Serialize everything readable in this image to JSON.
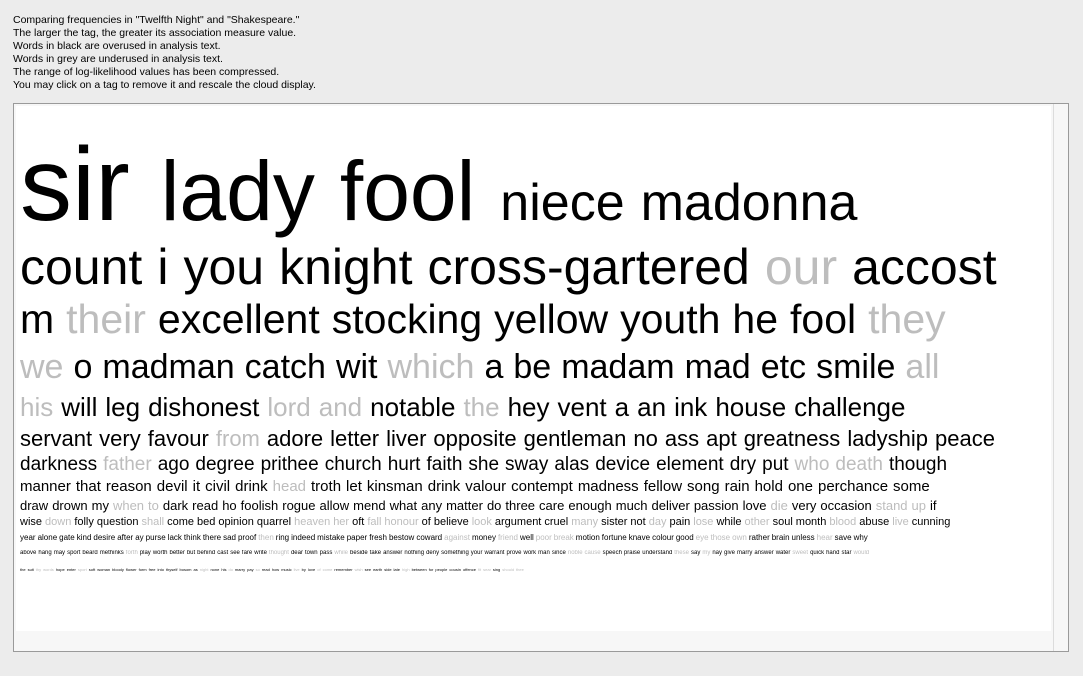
{
  "header_lines": [
    "Comparing frequencies in \"Twelfth Night\" and \"Shakespeare.\"",
    "The larger the tag, the greater its association measure value.",
    "Words in black are overused in analysis text.",
    "Words in grey are underused in analysis text.",
    "The range of log-likelihood values has been compressed.",
    "You may click on a tag to remove it and rescale the cloud display."
  ],
  "colors": {
    "overused": "#000000",
    "underused": "#bdbdbd"
  },
  "lines": [
    {
      "size": 104,
      "words": [
        [
          "sir",
          "o"
        ]
      ]
    },
    {
      "size": 84,
      "words": [
        [
          "lady",
          "o"
        ],
        [
          "fool",
          "o"
        ]
      ]
    },
    {
      "size": 52,
      "words": [
        [
          "niece",
          "o"
        ],
        [
          "madonna",
          "o"
        ]
      ]
    },
    {
      "size": 50,
      "words": [
        [
          "count",
          "o"
        ],
        [
          "i",
          "o"
        ],
        [
          "you",
          "o"
        ],
        [
          "knight",
          "o"
        ],
        [
          "cross-gartered",
          "o"
        ],
        [
          "our",
          "u"
        ],
        [
          "accost",
          "o"
        ]
      ]
    },
    {
      "size": 41,
      "words": [
        [
          "m",
          "o"
        ],
        [
          "their",
          "u"
        ],
        [
          "excellent",
          "o"
        ],
        [
          "stocking",
          "o"
        ],
        [
          "yellow",
          "o"
        ],
        [
          "youth",
          "o"
        ],
        [
          "he",
          "o"
        ],
        [
          "fool",
          "o"
        ],
        [
          "they",
          "u"
        ]
      ]
    },
    {
      "size": 34,
      "words": [
        [
          "we",
          "u"
        ],
        [
          "o",
          "o"
        ],
        [
          "madman",
          "o"
        ],
        [
          "catch",
          "o"
        ],
        [
          "wit",
          "o"
        ],
        [
          "which",
          "u"
        ],
        [
          "a",
          "o"
        ],
        [
          "be",
          "o"
        ],
        [
          "madam",
          "o"
        ],
        [
          "mad",
          "o"
        ],
        [
          "etc",
          "o"
        ],
        [
          "smile",
          "o"
        ],
        [
          "all",
          "u"
        ]
      ]
    },
    {
      "size": 26,
      "words": [
        [
          "his",
          "u"
        ],
        [
          "will",
          "o"
        ],
        [
          "leg",
          "o"
        ],
        [
          "dishonest",
          "o"
        ],
        [
          "lord",
          "u"
        ],
        [
          "and",
          "u"
        ],
        [
          "notable",
          "o"
        ],
        [
          "the",
          "u"
        ],
        [
          "hey",
          "o"
        ],
        [
          "vent",
          "o"
        ],
        [
          "a",
          "o"
        ],
        [
          "an",
          "o"
        ],
        [
          "ink",
          "o"
        ],
        [
          "house",
          "o"
        ],
        [
          "challenge",
          "o"
        ]
      ]
    },
    {
      "size": 22,
      "words": [
        [
          "servant",
          "o"
        ],
        [
          "very",
          "o"
        ],
        [
          "favour",
          "o"
        ],
        [
          "from",
          "u"
        ],
        [
          "adore",
          "o"
        ],
        [
          "letter",
          "o"
        ],
        [
          "liver",
          "o"
        ],
        [
          "opposite",
          "o"
        ],
        [
          "gentleman",
          "o"
        ],
        [
          "no",
          "o"
        ],
        [
          "ass",
          "o"
        ],
        [
          "apt",
          "o"
        ],
        [
          "greatness",
          "o"
        ],
        [
          "ladyship",
          "o"
        ],
        [
          "peace",
          "o"
        ]
      ]
    },
    {
      "size": 19,
      "words": [
        [
          "darkness",
          "o"
        ],
        [
          "father",
          "u"
        ],
        [
          "ago",
          "o"
        ],
        [
          "degree",
          "o"
        ],
        [
          "prithee",
          "o"
        ],
        [
          "church",
          "o"
        ],
        [
          "hurt",
          "o"
        ],
        [
          "faith",
          "o"
        ],
        [
          "she",
          "o"
        ],
        [
          "sway",
          "o"
        ],
        [
          "alas",
          "o"
        ],
        [
          "device",
          "o"
        ],
        [
          "element",
          "o"
        ],
        [
          "dry",
          "o"
        ],
        [
          "put",
          "o"
        ],
        [
          "who",
          "u"
        ],
        [
          "death",
          "u"
        ],
        [
          "though",
          "o"
        ]
      ]
    },
    {
      "size": 15,
      "words": [
        [
          "manner",
          "o"
        ],
        [
          "that",
          "o"
        ],
        [
          "reason",
          "o"
        ],
        [
          "devil",
          "o"
        ],
        [
          "it",
          "o"
        ],
        [
          "civil",
          "o"
        ],
        [
          "drink",
          "o"
        ],
        [
          "head",
          "u"
        ],
        [
          "troth",
          "o"
        ],
        [
          "let",
          "o"
        ],
        [
          "kinsman",
          "o"
        ],
        [
          "drink",
          "o"
        ],
        [
          "valour",
          "o"
        ],
        [
          "contempt",
          "o"
        ],
        [
          "madness",
          "o"
        ],
        [
          "fellow",
          "o"
        ],
        [
          "song",
          "o"
        ],
        [
          "rain",
          "o"
        ],
        [
          "hold",
          "o"
        ],
        [
          "one",
          "o"
        ],
        [
          "perchance",
          "o"
        ],
        [
          "some",
          "o"
        ]
      ]
    },
    {
      "size": 13,
      "words": [
        [
          "draw",
          "o"
        ],
        [
          "drown",
          "o"
        ],
        [
          "my",
          "o"
        ],
        [
          "when",
          "u"
        ],
        [
          "to",
          "u"
        ],
        [
          "dark",
          "o"
        ],
        [
          "read",
          "o"
        ],
        [
          "ho",
          "o"
        ],
        [
          "foolish",
          "o"
        ],
        [
          "rogue",
          "o"
        ],
        [
          "allow",
          "o"
        ],
        [
          "mend",
          "o"
        ],
        [
          "what",
          "o"
        ],
        [
          "any",
          "o"
        ],
        [
          "matter",
          "o"
        ],
        [
          "do",
          "o"
        ],
        [
          "three",
          "o"
        ],
        [
          "care",
          "o"
        ],
        [
          "enough",
          "o"
        ],
        [
          "much",
          "o"
        ],
        [
          "deliver",
          "o"
        ],
        [
          "passion",
          "o"
        ],
        [
          "love",
          "o"
        ],
        [
          "die",
          "u"
        ],
        [
          "very",
          "o"
        ],
        [
          "occasion",
          "o"
        ],
        [
          "stand",
          "u"
        ],
        [
          "up",
          "u"
        ],
        [
          "if",
          "o"
        ]
      ]
    },
    {
      "size": 11,
      "words": [
        [
          "wise",
          "o"
        ],
        [
          "down",
          "u"
        ],
        [
          "folly",
          "o"
        ],
        [
          "question",
          "o"
        ],
        [
          "shall",
          "u"
        ],
        [
          "come",
          "o"
        ],
        [
          "bed",
          "o"
        ],
        [
          "opinion",
          "o"
        ],
        [
          "quarrel",
          "o"
        ],
        [
          "heaven",
          "u"
        ],
        [
          "her",
          "u"
        ],
        [
          "oft",
          "o"
        ],
        [
          "fall",
          "u"
        ],
        [
          "honour",
          "u"
        ],
        [
          "of",
          "o"
        ],
        [
          "believe",
          "o"
        ],
        [
          "look",
          "u"
        ],
        [
          "argument",
          "o"
        ],
        [
          "cruel",
          "o"
        ],
        [
          "many",
          "u"
        ],
        [
          "sister",
          "o"
        ],
        [
          "not",
          "o"
        ],
        [
          "day",
          "u"
        ],
        [
          "pain",
          "o"
        ],
        [
          "lose",
          "u"
        ],
        [
          "while",
          "o"
        ],
        [
          "other",
          "u"
        ],
        [
          "soul",
          "o"
        ],
        [
          "month",
          "o"
        ],
        [
          "blood",
          "u"
        ],
        [
          "abuse",
          "o"
        ],
        [
          "live",
          "u"
        ],
        [
          "cunning",
          "o"
        ]
      ]
    },
    {
      "size": 8,
      "words": [
        [
          "year",
          "o"
        ],
        [
          "alone",
          "o"
        ],
        [
          "gate",
          "o"
        ],
        [
          "kind",
          "o"
        ],
        [
          "desire",
          "o"
        ],
        [
          "after",
          "o"
        ],
        [
          "ay",
          "o"
        ],
        [
          "purse",
          "o"
        ],
        [
          "lack",
          "o"
        ],
        [
          "think",
          "o"
        ],
        [
          "there",
          "o"
        ],
        [
          "sad",
          "o"
        ],
        [
          "proof",
          "o"
        ],
        [
          "then",
          "u"
        ],
        [
          "ring",
          "o"
        ],
        [
          "indeed",
          "o"
        ],
        [
          "mistake",
          "o"
        ],
        [
          "paper",
          "o"
        ],
        [
          "fresh",
          "o"
        ],
        [
          "bestow",
          "o"
        ],
        [
          "coward",
          "o"
        ],
        [
          "against",
          "u"
        ],
        [
          "money",
          "o"
        ],
        [
          "friend",
          "u"
        ],
        [
          "well",
          "o"
        ],
        [
          "poor",
          "u"
        ],
        [
          "break",
          "u"
        ],
        [
          "motion",
          "o"
        ],
        [
          "fortune",
          "o"
        ],
        [
          "knave",
          "o"
        ],
        [
          "colour",
          "o"
        ],
        [
          "good",
          "o"
        ],
        [
          "eye",
          "u"
        ],
        [
          "those",
          "u"
        ],
        [
          "own",
          "u"
        ],
        [
          "rather",
          "o"
        ],
        [
          "brain",
          "o"
        ],
        [
          "unless",
          "o"
        ],
        [
          "hear",
          "u"
        ],
        [
          "save",
          "o"
        ],
        [
          "why",
          "o"
        ]
      ]
    },
    {
      "size": 6,
      "words": [
        [
          "above",
          "o"
        ],
        [
          "hang",
          "o"
        ],
        [
          "may",
          "o"
        ],
        [
          "sport",
          "o"
        ],
        [
          "beard",
          "o"
        ],
        [
          "methinks",
          "o"
        ],
        [
          "forth",
          "u"
        ],
        [
          "play",
          "o"
        ],
        [
          "worth",
          "o"
        ],
        [
          "better",
          "o"
        ],
        [
          "but",
          "o"
        ],
        [
          "behind",
          "o"
        ],
        [
          "cast",
          "o"
        ],
        [
          "see",
          "o"
        ],
        [
          "fare",
          "o"
        ],
        [
          "write",
          "o"
        ],
        [
          "thought",
          "u"
        ],
        [
          "dear",
          "o"
        ],
        [
          "town",
          "o"
        ],
        [
          "pass",
          "o"
        ],
        [
          "while",
          "u"
        ],
        [
          "beside",
          "o"
        ],
        [
          "take",
          "o"
        ],
        [
          "answer",
          "o"
        ],
        [
          "nothing",
          "o"
        ],
        [
          "deny",
          "o"
        ],
        [
          "something",
          "o"
        ],
        [
          "your",
          "o"
        ],
        [
          "warrant",
          "o"
        ],
        [
          "prove",
          "o"
        ],
        [
          "work",
          "o"
        ],
        [
          "man",
          "o"
        ],
        [
          "since",
          "o"
        ],
        [
          "noble",
          "u"
        ],
        [
          "cause",
          "u"
        ],
        [
          "speech",
          "o"
        ],
        [
          "praise",
          "o"
        ],
        [
          "understand",
          "o"
        ],
        [
          "these",
          "u"
        ],
        [
          "say",
          "o"
        ],
        [
          "my",
          "u"
        ],
        [
          "nay",
          "o"
        ],
        [
          "give",
          "o"
        ],
        [
          "marry",
          "o"
        ],
        [
          "answer",
          "o"
        ],
        [
          "water",
          "o"
        ],
        [
          "sweet",
          "u"
        ],
        [
          "quick",
          "o"
        ],
        [
          "hand",
          "o"
        ],
        [
          "star",
          "o"
        ],
        [
          "would",
          "u"
        ]
      ]
    },
    {
      "size": 4,
      "words": [
        [
          "the",
          "o"
        ],
        [
          "suit",
          "o"
        ],
        [
          "thy",
          "u"
        ],
        [
          "words",
          "u"
        ],
        [
          "hope",
          "o"
        ],
        [
          "enter",
          "o"
        ],
        [
          "sport",
          "u"
        ],
        [
          "soft",
          "o"
        ],
        [
          "woman",
          "o"
        ],
        [
          "bloody",
          "o"
        ],
        [
          "flower",
          "o"
        ],
        [
          "form",
          "o"
        ],
        [
          "free",
          "o"
        ],
        [
          "into",
          "o"
        ],
        [
          "thyself",
          "o"
        ],
        [
          "bosom",
          "o"
        ],
        [
          "as",
          "o"
        ],
        [
          "night",
          "u"
        ],
        [
          "none",
          "o"
        ],
        [
          "his",
          "o"
        ],
        [
          "do",
          "u"
        ],
        [
          "marry",
          "o"
        ],
        [
          "pay",
          "o"
        ],
        [
          "so",
          "u"
        ],
        [
          "read",
          "o"
        ],
        [
          "how",
          "o"
        ],
        [
          "music",
          "o"
        ],
        [
          "live",
          "u"
        ],
        [
          "by",
          "o"
        ],
        [
          "love",
          "o"
        ],
        [
          "of",
          "u"
        ],
        [
          "come",
          "u"
        ],
        [
          "remember",
          "o"
        ],
        [
          "wish",
          "u"
        ],
        [
          "see",
          "o"
        ],
        [
          "earth",
          "o"
        ],
        [
          "side",
          "o"
        ],
        [
          "late",
          "o"
        ],
        [
          "high",
          "u"
        ],
        [
          "between",
          "o"
        ],
        [
          "for",
          "o"
        ],
        [
          "people",
          "o"
        ],
        [
          "cousin",
          "o"
        ],
        [
          "offence",
          "o"
        ],
        [
          "fit",
          "u"
        ],
        [
          "sear",
          "u"
        ],
        [
          "sing",
          "o"
        ],
        [
          "should",
          "u"
        ],
        [
          "thee",
          "u"
        ]
      ]
    }
  ]
}
